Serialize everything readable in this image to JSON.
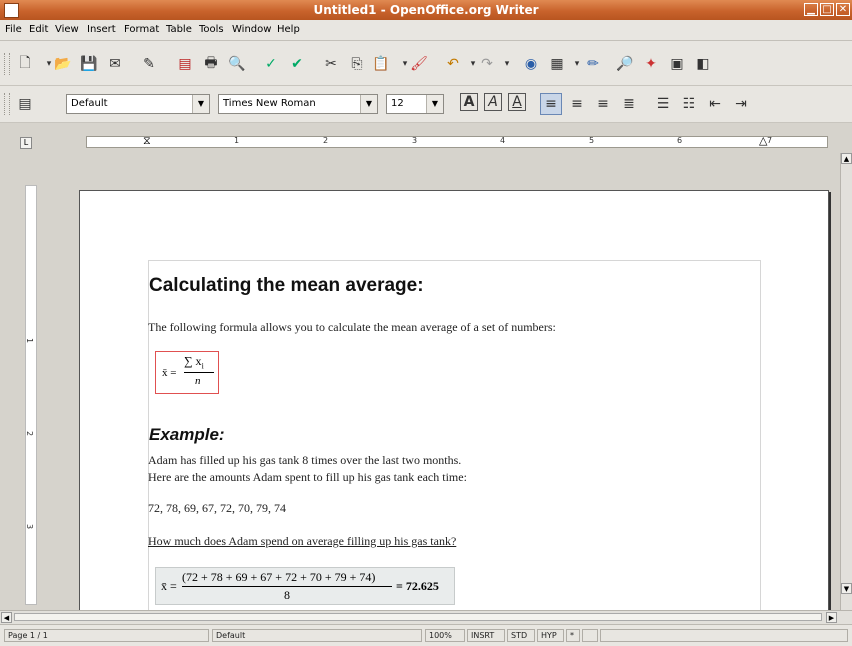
{
  "window": {
    "title": "Untitled1 - OpenOffice.org Writer"
  },
  "menu": [
    "File",
    "Edit",
    "View",
    "Insert",
    "Format",
    "Table",
    "Tools",
    "Window",
    "Help"
  ],
  "formatting": {
    "style": "Default",
    "font": "Times New Roman",
    "size": "12"
  },
  "ruler": {
    "numbers": [
      "1",
      "2",
      "3",
      "4",
      "5",
      "6",
      "7"
    ],
    "vnumbers": [
      "1",
      "2",
      "3"
    ]
  },
  "document": {
    "heading": "Calculating the mean average:",
    "intro": "The following formula allows you to calculate the mean average of a set of numbers:",
    "formula1": {
      "lhs": "x̄ =",
      "num": "∑ x",
      "sub": "i",
      "den": "n"
    },
    "example_heading": "Example:",
    "line1": "Adam has filled up his gas tank 8 times over the last two months.",
    "line2": "Here are the amounts Adam spent to fill up his gas tank each time:",
    "values": "72, 78, 69, 67, 72, 70, 79, 74",
    "question": "How much does Adam spend on average filling up his gas tank?",
    "formula2": {
      "lhs": "x̄ =",
      "num": "(72 + 78 + 69 + 67 + 72 + 70 + 79 + 74)",
      "den": "8",
      "result": "= 72.625"
    }
  },
  "status": {
    "page": "Page 1 / 1",
    "style": "Default",
    "zoom": "100%",
    "insert": "INSRT",
    "std": "STD",
    "hyp": "HYP",
    "modified": "*"
  }
}
